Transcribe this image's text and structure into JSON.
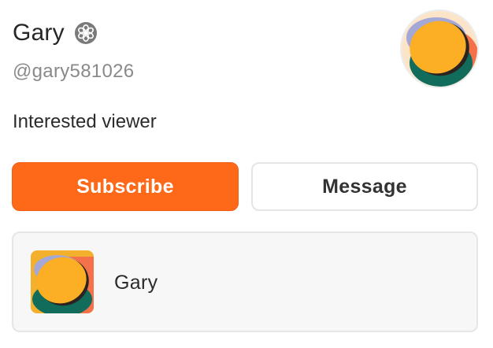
{
  "profile": {
    "display_name": "Gary",
    "handle": "@gary581026",
    "bio": "Interested viewer",
    "badge_icon": "verified-flower-icon",
    "avatar_icon": "avatar-abstract-art"
  },
  "actions": {
    "subscribe_label": "Subscribe",
    "message_label": "Message"
  },
  "publication": {
    "name": "Gary",
    "logo_icon": "publication-logo-abstract-art"
  },
  "colors": {
    "accent": "#fe6819",
    "avatar_orange": "#fcae25",
    "avatar_green": "#126c5b",
    "avatar_coral": "#f4714a",
    "avatar_lavender": "#a3a8d6"
  }
}
